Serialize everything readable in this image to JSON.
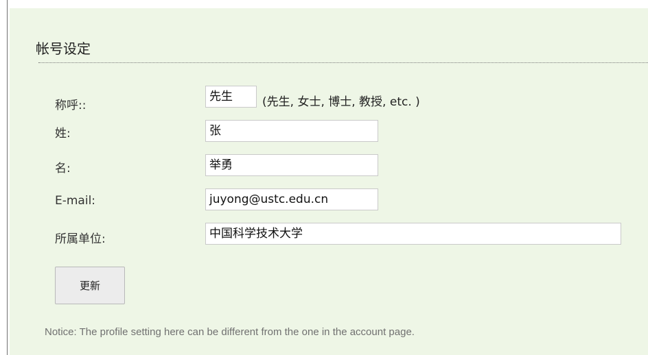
{
  "section": {
    "title": "帐号设定"
  },
  "form": {
    "fields": [
      {
        "label": "称呼::",
        "value": "先生"
      },
      {
        "label": "姓:",
        "value": "张"
      },
      {
        "label": "名:",
        "value": "举勇"
      },
      {
        "label": "E-mail:",
        "value": "juyong@ustc.edu.cn"
      },
      {
        "label": "所属单位:",
        "value": "中国科学技术大学"
      }
    ],
    "title_hint": "(先生, 女士, 博士, 教授, etc. )",
    "update_label": "更新"
  },
  "notice": "Notice: The profile setting here can be different from the one in the account page."
}
